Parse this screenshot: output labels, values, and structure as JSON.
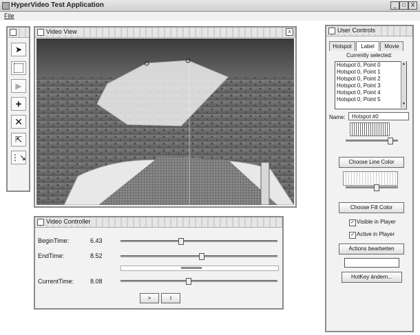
{
  "window": {
    "title": "HyperVideo Test Application",
    "minimize": "_",
    "maximize": "□",
    "close": "X"
  },
  "menu": {
    "file": "File"
  },
  "video_view": {
    "title": "Video View",
    "close": "x"
  },
  "video_controller": {
    "title": "Video Controller",
    "begin_label": "BeginTime:",
    "begin_value": "6.43",
    "begin_level": 0.38,
    "end_label": "EndTime:",
    "end_value": "8.52",
    "end_level": 0.52,
    "current_label": "CurrentTime:",
    "current_value": "8.08",
    "current_level": 0.43,
    "range_level": 0.38,
    "play_label": ">",
    "pause_label": "I"
  },
  "user_controls": {
    "title": "User Controls",
    "tabs": [
      "Hotspot",
      "Label",
      "Movie"
    ],
    "selected_tab": "Label",
    "currently_selected": "Currently selected:",
    "hotspots": [
      "Hotspot 0, Point 0",
      "Hotspot 0, Point 1",
      "Hotspot 0, Point 2",
      "Hotspot 0, Point 3",
      "Hotspot 0, Point 4",
      "Hotspot 0, Point 5"
    ],
    "name_label": "Name:",
    "name_value": "Hotspot #0",
    "line_slider_level": 0.9,
    "fill_slider_level": 0.6,
    "choose_line_color": "Choose Line Color",
    "choose_fill_color": "Choose Fill Color",
    "visible_label": "Visible in Player",
    "active_label": "Active in Player",
    "actions_button": "Actions bearbeiten",
    "hotkey_button": "HotKey ändern..."
  },
  "colors": {
    "panel_border": "#8a8a8a",
    "panel_bg": "#f2f2f2"
  }
}
